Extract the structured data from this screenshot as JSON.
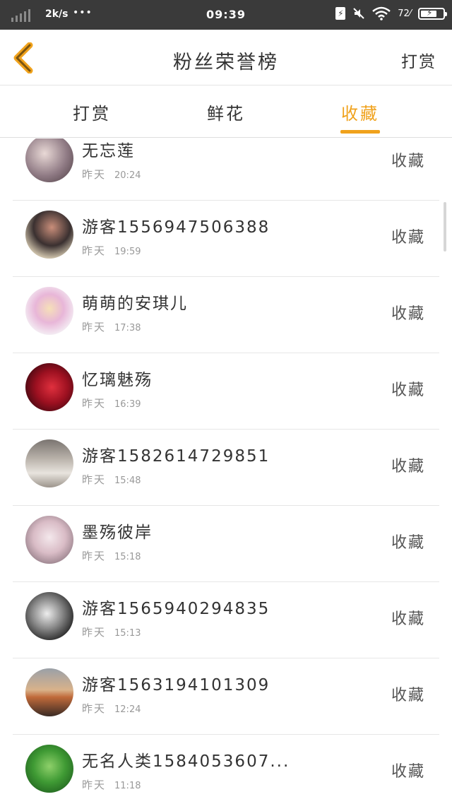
{
  "status_bar": {
    "network_speed": "2k/s",
    "dots": "•••",
    "time": "09:39",
    "battery_percent": "72",
    "battery_level": 0.72,
    "icons": [
      "signal-icon",
      "battery-saver-icon",
      "mute-icon",
      "wifi-icon",
      "battery-icon"
    ]
  },
  "header": {
    "title": "粉丝荣誉榜",
    "action": "打赏",
    "back_icon": "chevron-left-icon",
    "accent_color": "#f0a21c"
  },
  "tabs": [
    {
      "label": "打赏",
      "active": false
    },
    {
      "label": "鲜花",
      "active": false
    },
    {
      "label": "收藏",
      "active": true
    }
  ],
  "rows": [
    {
      "name": "无忘莲",
      "day": "昨天",
      "time": "20:24",
      "type": "收藏"
    },
    {
      "name": "游客1556947506388",
      "day": "昨天",
      "time": "19:59",
      "type": "收藏"
    },
    {
      "name": "萌萌的安琪儿",
      "day": "昨天",
      "time": "17:38",
      "type": "收藏"
    },
    {
      "name": "忆璃魅殇",
      "day": "昨天",
      "time": "16:39",
      "type": "收藏"
    },
    {
      "name": "游客1582614729851",
      "day": "昨天",
      "time": "15:48",
      "type": "收藏"
    },
    {
      "name": "墨殇彼岸",
      "day": "昨天",
      "time": "15:18",
      "type": "收藏"
    },
    {
      "name": "游客1565940294835",
      "day": "昨天",
      "time": "15:13",
      "type": "收藏"
    },
    {
      "name": "游客1563194101309",
      "day": "昨天",
      "time": "12:24",
      "type": "收藏"
    },
    {
      "name": "无名人类1584053607...",
      "day": "昨天",
      "time": "11:18",
      "type": "收藏"
    }
  ]
}
